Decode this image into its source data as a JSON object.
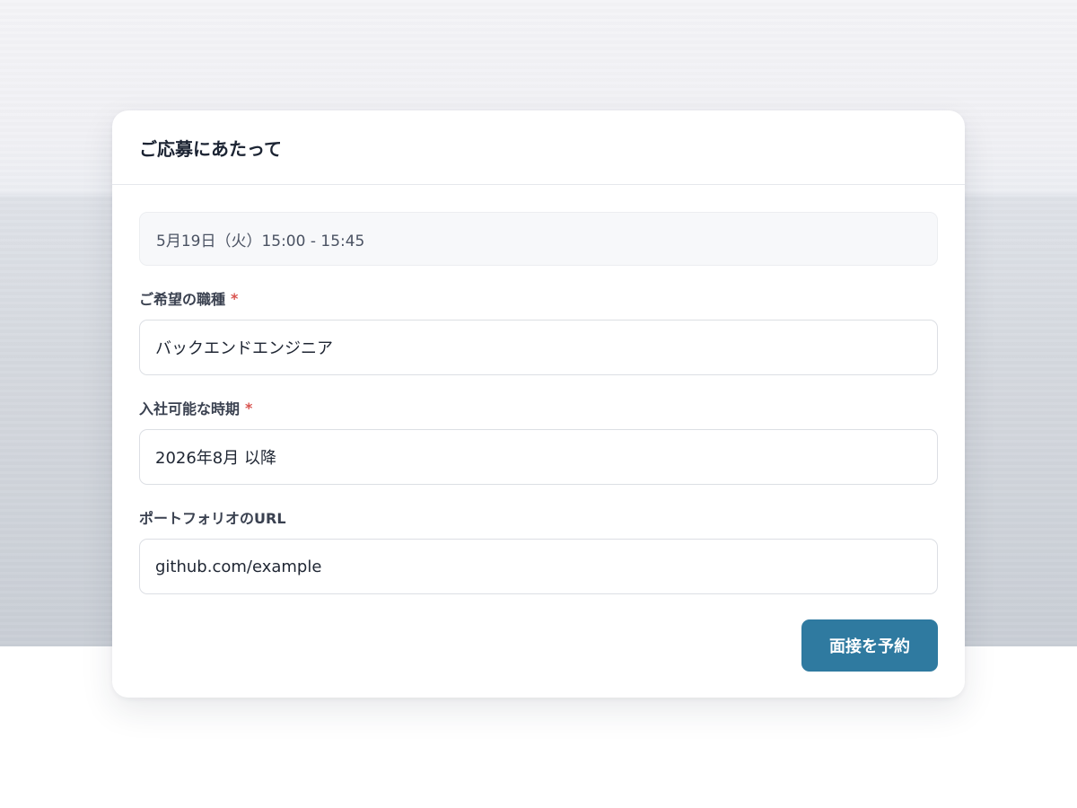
{
  "form": {
    "title": "ご応募にあたって",
    "selected_slot": "5月19日（火）15:00 - 15:45",
    "fields": [
      {
        "label": "ご希望の職種",
        "required": true,
        "required_mark": "*",
        "value": "バックエンドエンジニア"
      },
      {
        "label": "入社可能な時期",
        "required": true,
        "required_mark": "*",
        "value": "2026年8月 以降"
      },
      {
        "label": "ポートフォリオのURL",
        "required": false,
        "value": "github.com/example"
      }
    ],
    "submit_label": "面接を予約"
  },
  "colors": {
    "accent": "#2f7aa0",
    "required": "#d9534f",
    "title_text": "#1c2433",
    "label_text": "#3a4150"
  }
}
